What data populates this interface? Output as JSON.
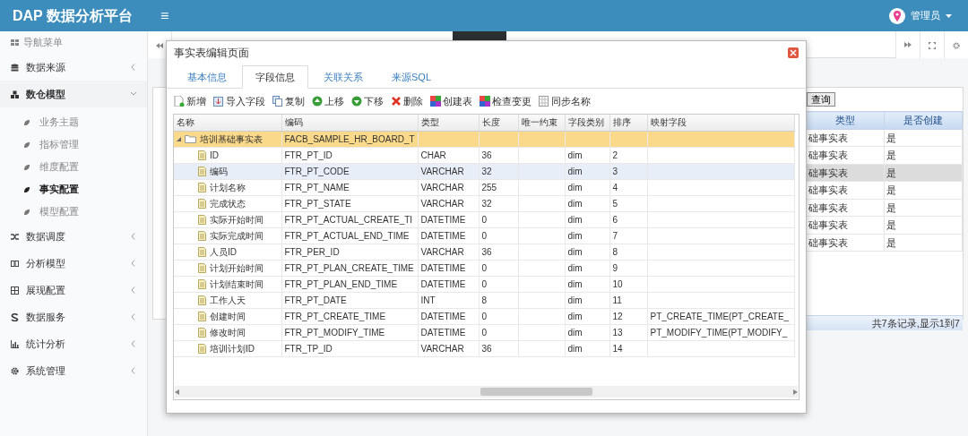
{
  "header": {
    "logo": "DAP 数据分析平台",
    "menu_toggle": "≡",
    "user": "管理员"
  },
  "sidebar": {
    "title": "导航菜单",
    "items": [
      {
        "label": "数据来源",
        "expanded": false
      },
      {
        "label": "数仓模型",
        "expanded": true,
        "children": [
          {
            "label": "业务主题",
            "selected": false
          },
          {
            "label": "指标管理",
            "selected": false
          },
          {
            "label": "维度配置",
            "selected": false
          },
          {
            "label": "事实配置",
            "selected": true
          },
          {
            "label": "模型配置",
            "selected": false
          }
        ]
      },
      {
        "label": "数据调度",
        "expanded": false
      },
      {
        "label": "分析模型",
        "expanded": false
      },
      {
        "label": "展现配置",
        "expanded": false
      },
      {
        "label": "数据服务",
        "expanded": false
      },
      {
        "label": "统计分析",
        "expanded": false
      },
      {
        "label": "系统管理",
        "expanded": false
      }
    ]
  },
  "background_grid": {
    "button": "查询",
    "columns": [
      "类型",
      "是否创建"
    ],
    "rows": [
      {
        "cells": [
          "础事实表",
          "是"
        ],
        "selected": false
      },
      {
        "cells": [
          "础事实表",
          "是"
        ],
        "selected": false
      },
      {
        "cells": [
          "础事实表",
          "是"
        ],
        "selected": true
      },
      {
        "cells": [
          "础事实表",
          "是"
        ],
        "selected": false
      },
      {
        "cells": [
          "础事实表",
          "是"
        ],
        "selected": false
      },
      {
        "cells": [
          "础事实表",
          "是"
        ],
        "selected": false
      },
      {
        "cells": [
          "础事实表",
          "是"
        ],
        "selected": false
      }
    ],
    "footer": "共7条记录,显示1到7"
  },
  "dialog": {
    "title": "事实表编辑页面",
    "tabs": [
      {
        "label": "基本信息",
        "selected": false
      },
      {
        "label": "字段信息",
        "selected": true
      },
      {
        "label": "关联关系",
        "selected": false
      },
      {
        "label": "来源SQL",
        "selected": false
      }
    ],
    "toolbar": [
      "新增",
      "导入字段",
      "复制",
      "上移",
      "下移",
      "删除",
      "创建表",
      "检查变更",
      "同步名称"
    ],
    "grid": {
      "columns": [
        "名称",
        "编码",
        "类型",
        "长度",
        "唯一约束",
        "字段类别",
        "排序",
        "映射字段"
      ],
      "rows": [
        {
          "cells": [
            "培训基础事实表",
            "FACB_SAMPLE_HR_BOARD_T",
            "",
            "",
            "",
            "",
            "",
            ""
          ],
          "expanded": true,
          "selected": true,
          "children": [
            {
              "cells": [
                "ID",
                "FTR_PT_ID",
                "CHAR",
                "36",
                "",
                "dim",
                "2",
                ""
              ],
              "selected": false,
              "hovered": false
            },
            {
              "cells": [
                "编码",
                "FTR_PT_CODE",
                "VARCHAR",
                "32",
                "",
                "dim",
                "3",
                ""
              ],
              "selected": false,
              "hovered": true
            },
            {
              "cells": [
                "计划名称",
                "FTR_PT_NAME",
                "VARCHAR",
                "255",
                "",
                "dim",
                "4",
                ""
              ],
              "selected": false,
              "hovered": false
            },
            {
              "cells": [
                "完成状态",
                "FTR_PT_STATE",
                "VARCHAR",
                "32",
                "",
                "dim",
                "5",
                ""
              ],
              "selected": false,
              "hovered": false
            },
            {
              "cells": [
                "实际开始时间",
                "FTR_PT_ACTUAL_CREATE_TI",
                "DATETIME",
                "0",
                "",
                "dim",
                "6",
                ""
              ],
              "selected": false,
              "hovered": false
            },
            {
              "cells": [
                "实际完成时间",
                "FTR_PT_ACTUAL_END_TIME",
                "DATETIME",
                "0",
                "",
                "dim",
                "7",
                ""
              ],
              "selected": false,
              "hovered": false
            },
            {
              "cells": [
                "人员ID",
                "FTR_PER_ID",
                "VARCHAR",
                "36",
                "",
                "dim",
                "8",
                ""
              ],
              "selected": false,
              "hovered": false
            },
            {
              "cells": [
                "计划开始时间",
                "FTR_PT_PLAN_CREATE_TIME",
                "DATETIME",
                "0",
                "",
                "dim",
                "9",
                ""
              ],
              "selected": false,
              "hovered": false
            },
            {
              "cells": [
                "计划结束时间",
                "FTR_PT_PLAN_END_TIME",
                "DATETIME",
                "0",
                "",
                "dim",
                "10",
                ""
              ],
              "selected": false,
              "hovered": false
            },
            {
              "cells": [
                "工作人天",
                "FTR_PT_DATE",
                "INT",
                "8",
                "",
                "dim",
                "11",
                ""
              ],
              "selected": false,
              "hovered": false
            },
            {
              "cells": [
                "创建时间",
                "FTR_PT_CREATE_TIME",
                "DATETIME",
                "0",
                "",
                "dim",
                "12",
                "PT_CREATE_TIME(PT_CREATE_"
              ],
              "selected": false,
              "hovered": false
            },
            {
              "cells": [
                "修改时间",
                "FTR_PT_MODIFY_TIME",
                "DATETIME",
                "0",
                "",
                "dim",
                "13",
                "PT_MODIFY_TIME(PT_MODIFY_"
              ],
              "selected": false,
              "hovered": false
            },
            {
              "cells": [
                "培训计划ID",
                "FTR_TP_ID",
                "VARCHAR",
                "36",
                "",
                "dim",
                "14",
                ""
              ],
              "selected": false,
              "hovered": false
            }
          ]
        }
      ]
    }
  }
}
